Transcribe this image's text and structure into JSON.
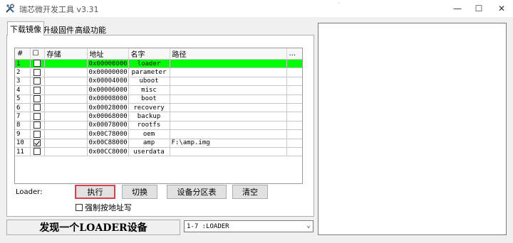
{
  "window": {
    "title": "瑞芯微开发工具 v3.31",
    "minimize": "—",
    "maximize": "☐",
    "close": "✕",
    "colors": {
      "selected_row": "#00ff00",
      "exec_border": "#d9404b"
    }
  },
  "tabs": [
    "下载镜像",
    "升级固件",
    "高级功能"
  ],
  "table": {
    "columns": [
      "#",
      "☐",
      "存储",
      "地址",
      "名字",
      "路径",
      "..."
    ],
    "rows": [
      {
        "num": "1",
        "checked": false,
        "storage": "",
        "address": "0x00000000",
        "name": "loader",
        "path": "",
        "selected": true
      },
      {
        "num": "2",
        "checked": false,
        "storage": "",
        "address": "0x00000000",
        "name": "parameter",
        "path": "",
        "selected": false
      },
      {
        "num": "3",
        "checked": false,
        "storage": "",
        "address": "0x00004000",
        "name": "uboot",
        "path": "",
        "selected": false
      },
      {
        "num": "4",
        "checked": false,
        "storage": "",
        "address": "0x00006000",
        "name": "misc",
        "path": "",
        "selected": false
      },
      {
        "num": "5",
        "checked": false,
        "storage": "",
        "address": "0x00008000",
        "name": "boot",
        "path": "",
        "selected": false
      },
      {
        "num": "6",
        "checked": false,
        "storage": "",
        "address": "0x00028000",
        "name": "recovery",
        "path": "",
        "selected": false
      },
      {
        "num": "7",
        "checked": false,
        "storage": "",
        "address": "0x00068000",
        "name": "backup",
        "path": "",
        "selected": false
      },
      {
        "num": "8",
        "checked": false,
        "storage": "",
        "address": "0x00078000",
        "name": "rootfs",
        "path": "",
        "selected": false
      },
      {
        "num": "9",
        "checked": false,
        "storage": "",
        "address": "0x00C78000",
        "name": "oem",
        "path": "",
        "selected": false
      },
      {
        "num": "10",
        "checked": true,
        "storage": "",
        "address": "0x00C88000",
        "name": "amp",
        "path": "F:\\amp.img",
        "selected": false
      },
      {
        "num": "11",
        "checked": false,
        "storage": "",
        "address": "0x00CC8000",
        "name": "userdata",
        "path": "",
        "selected": false
      }
    ]
  },
  "actions": {
    "loader_label": "Loader:",
    "execute": "执行",
    "switch": "切换",
    "partition_table": "设备分区表",
    "clear": "清空"
  },
  "force_write": {
    "label": "强制按地址写",
    "checked": false
  },
  "status": {
    "message": "发现一个LOADER设备"
  },
  "device_select": {
    "value": "1-7 :LOADER"
  },
  "icons": {
    "app": "tools-icon",
    "dropdown": "chevron-down-icon",
    "checkmark": "checkmark-icon"
  }
}
